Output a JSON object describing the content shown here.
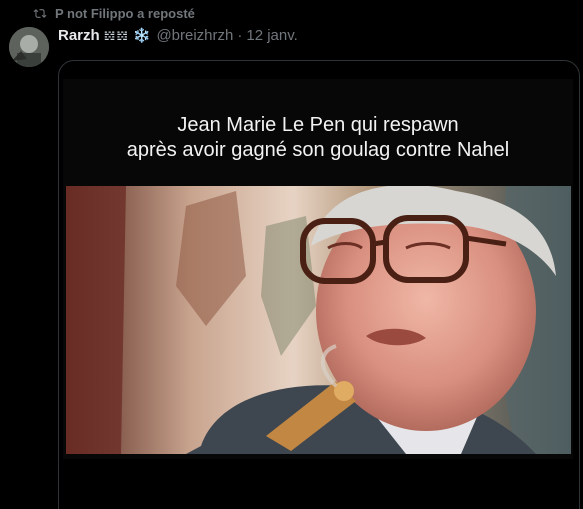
{
  "repost": {
    "icon": "repost-icon",
    "text": "P not Filippo a reposté"
  },
  "author": {
    "display_name": "Rarzh",
    "name_emoji": "𝍌𝍌",
    "name_snowflake": "❄️",
    "handle": "@breizhrzh",
    "separator": "·",
    "date": "12 janv."
  },
  "media": {
    "caption_line1": "Jean Marie Le Pen qui respawn",
    "caption_line2": "après avoir gagné son goulag contre Nahel"
  },
  "colors": {
    "background": "#000000",
    "text_primary": "#e7e9ea",
    "text_secondary": "#71767b",
    "border": "#2f3336"
  }
}
